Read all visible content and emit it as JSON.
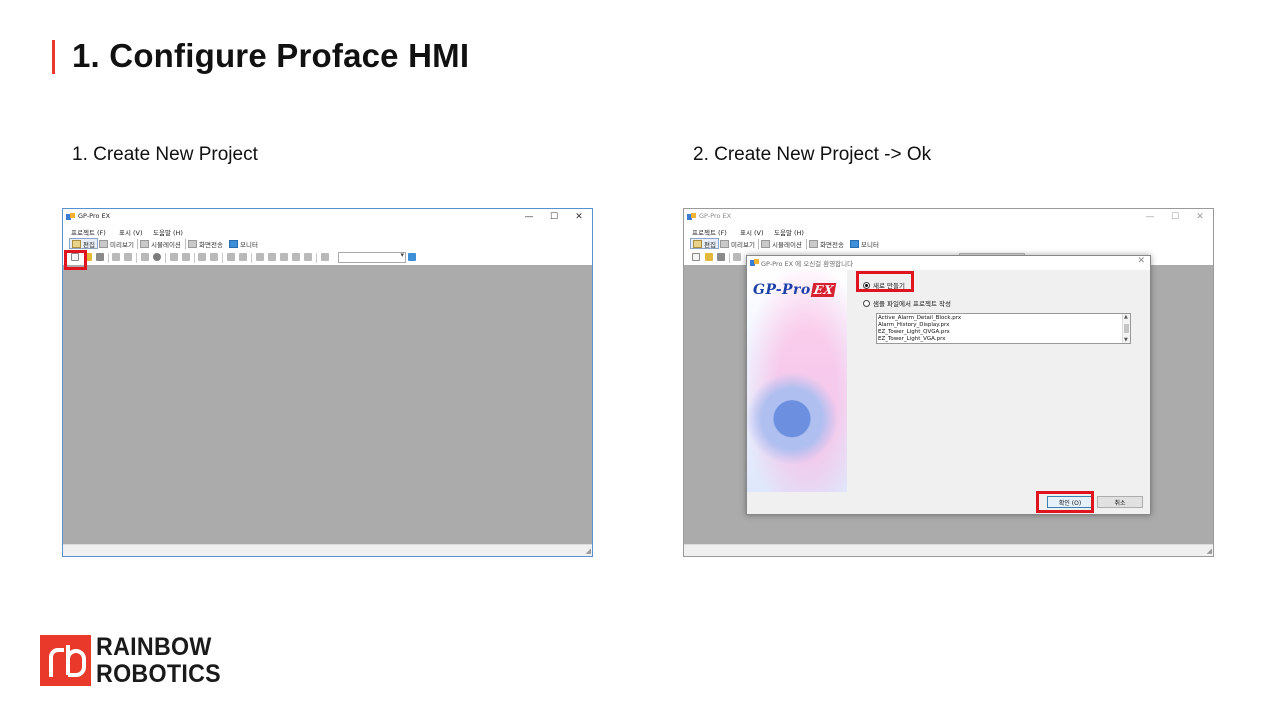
{
  "slide": {
    "title": "1. Configure Proface HMI",
    "accent_color": "#e8392b"
  },
  "steps": [
    {
      "caption": "1. Create New Project"
    },
    {
      "caption": "2. Create New Project -> Ok"
    }
  ],
  "app_window": {
    "title": "GP-Pro EX",
    "controls": {
      "minimize": "—",
      "maximize": "☐",
      "close": "✕"
    },
    "menu": [
      "프로젝트 (F)",
      "표시 (V)",
      "도움말 (H)"
    ],
    "modes": [
      "편집",
      "미리보기",
      "시뮬레이션",
      "화면전송",
      "모니터"
    ],
    "workarea_color": "#ababab"
  },
  "dialog": {
    "title": "GP-Pro EX 에 오신걸 환영합니다",
    "close": "✕",
    "logo_text": "GP-Pro",
    "logo_badge": "EX",
    "options": [
      {
        "label": "새로 만들기",
        "selected": true
      },
      {
        "label": "샘플 파일에서 프로젝트 작성",
        "selected": false
      }
    ],
    "sample_files": [
      "Active_Alarm_Detail_Block.prx",
      "Alarm_History_Display.prx",
      "EZ_Tower_Light_QVGA.prx",
      "EZ_Tower_Light_VGA.prx"
    ],
    "ok_label": "확인 (O)",
    "cancel_label": "취소"
  },
  "highlight_color": "#e0141e",
  "brand": {
    "mark": "rb",
    "line1": "RAINBOW",
    "line2": "ROBOTICS",
    "color": "#e8392b"
  }
}
